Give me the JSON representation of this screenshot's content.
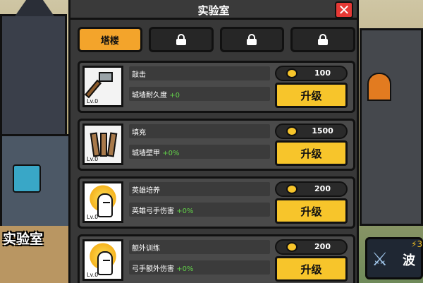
{
  "panel": {
    "title": "实验室",
    "close_icon": "close-x-icon"
  },
  "tabs": [
    {
      "label": "塔楼",
      "active": true
    },
    {
      "label": "",
      "locked": true,
      "icon": "lock-icon"
    },
    {
      "label": "",
      "locked": true,
      "icon": "lock-icon"
    },
    {
      "label": "",
      "locked": true,
      "icon": "lock-icon"
    }
  ],
  "rows": [
    {
      "icon": "hammer-icon",
      "level": "Lv.0",
      "name": "敲击",
      "stat": "城墙耐久度",
      "bonus": "+0",
      "cost": "100",
      "button": "升级"
    },
    {
      "icon": "wood-planks-icon",
      "level": "Lv.0",
      "name": "填充",
      "stat": "城墙壁甲",
      "bonus": "+0%",
      "cost": "1500",
      "button": "升级"
    },
    {
      "icon": "hero-icon",
      "level": "Lv.0",
      "name": "英雄培养",
      "stat": "英雄弓手伤害",
      "bonus": "+0%",
      "cost": "200",
      "button": "升级"
    },
    {
      "icon": "hero-icon",
      "level": "Lv.0",
      "name": "额外训练",
      "stat": "弓手额外伤害",
      "bonus": "+0%",
      "cost": "200",
      "button": "升级"
    }
  ],
  "background": {
    "building_label": "实验室",
    "wave_button_text": "波",
    "energy_text": "3"
  },
  "colors": {
    "accent": "#f3a42b",
    "button": "#f7c52b",
    "close": "#e63935",
    "bonus": "#63d14a"
  }
}
